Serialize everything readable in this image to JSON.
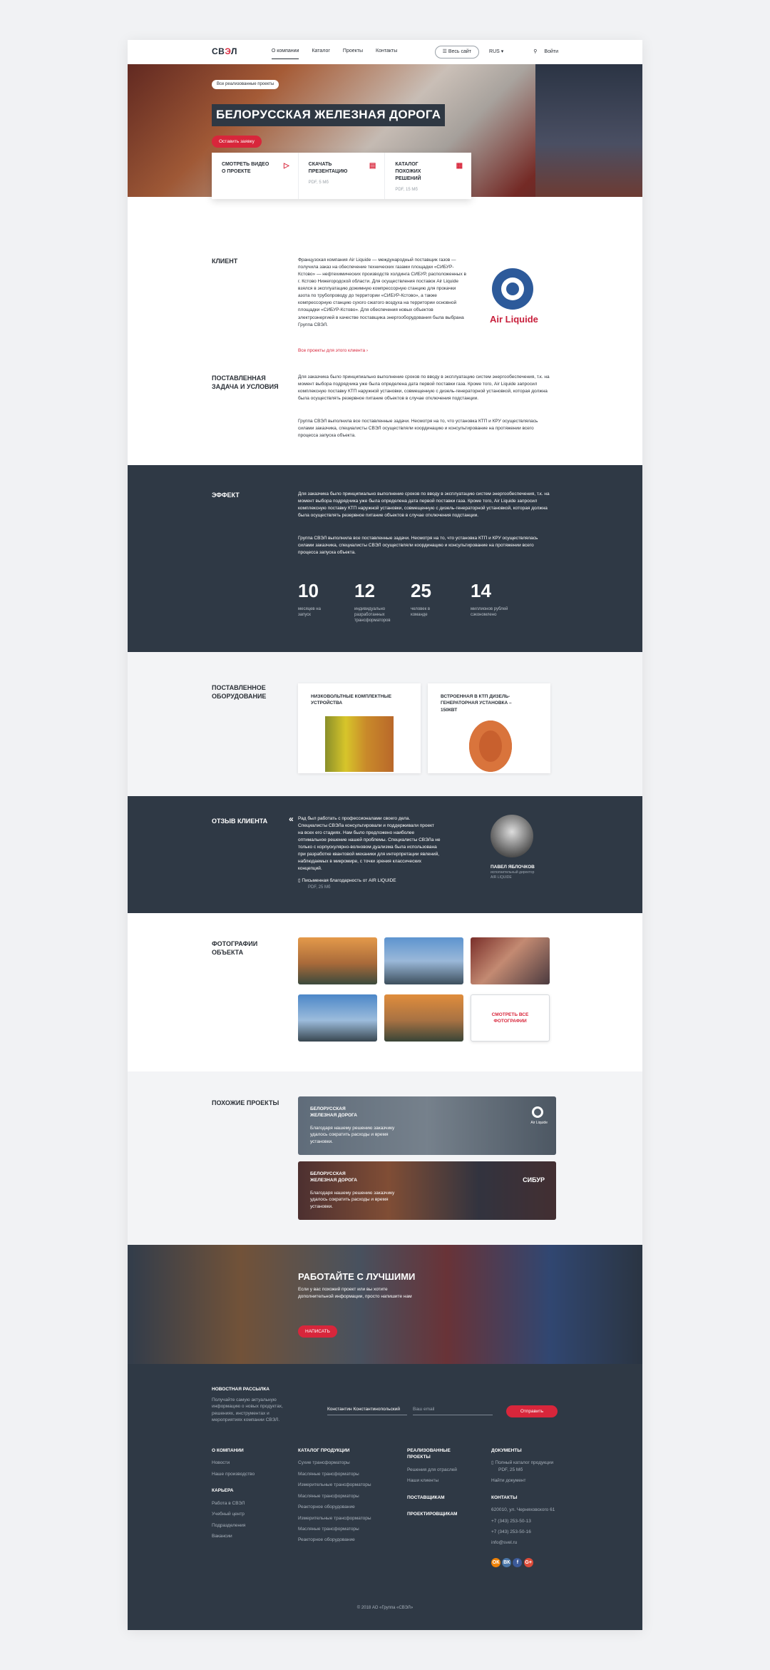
{
  "nav": {
    "logo_prefix": "СВ",
    "logo_accent": "Э",
    "logo_suffix": "Л",
    "items": [
      "О компании",
      "Каталог",
      "Проекты",
      "Контакты"
    ],
    "site_button": "Весь сайт",
    "lang": "RUS",
    "login": "Войти"
  },
  "hero": {
    "tag": "Все реализованные проекты",
    "title": "БЕЛОРУССКАЯ ЖЕЛЕЗНАЯ ДОРОГА",
    "cta": "Оставить заявку",
    "cards": [
      {
        "title": "СМОТРЕТЬ ВИДЕО О ПРОЕКТЕ",
        "sub": ""
      },
      {
        "title": "СКАЧАТЬ ПРЕЗЕНТАЦИЮ",
        "sub": "PDF, 5 Мб"
      },
      {
        "title": "КАТАЛОГ ПОХОЖИХ РЕШЕНИЙ",
        "sub": "PDF, 15 Мб"
      }
    ]
  },
  "client": {
    "heading": "КЛИЕНТ",
    "text": "Французская компания Air Liquide — международный поставщик газов — получила заказ на обеспечение технических газами площадки «СИБУР-Кстово» — нефтехимических производств холдинга СИБУР, расположенных в г. Кстово Нижегородской области. Для осуществления поставок Air Liquide взялся в эксплуатацию дожимную компрессорную станцию для прокачки азота по трубопроводу до территории «СИБУР-Кстово», а также компрессорную станцию сухого сжатого воздуха на территории основной площадки «СИБУР-Кстово». Для обеспечения новых объектов электроэнергией в качестве поставщика энергооборудования была выбрана Группа СВЭЛ.",
    "link": "Все проекты для этого клиента",
    "brand": "Air Liquide"
  },
  "task": {
    "heading": "ПОСТАВЛЕННАЯ ЗАДАЧА И УСЛОВИЯ",
    "p1": "Для заказчика было принципиально выполнение сроков по вводу в эксплуатацию систем энергообеспечения, т.к. на момент выбора подрядчика уже была определена дата первой поставки газа. Кроме того, Air Liquide запросил комплексную поставку КТП наружной установки, совмещенную с дизель-генераторной установкой, которая должна была осуществлять резервное питание объектов в случае отключения подстанции.",
    "p2": "Группа СВЭЛ выполнила все поставленные задачи. Несмотря на то, что установка КТП и КРУ осуществлялась силами заказчика, специалисты СВЭЛ осуществляли координацию и консультирование на протяжении всего процесса запуска объекта."
  },
  "effect": {
    "heading": "ЭФФЕКТ",
    "p1": "Для заказчика было принципиально выполнение сроков по вводу в эксплуатацию систем энергообеспечения, т.к. на момент выбора подрядчика уже была определена дата первой поставки газа. Кроме того, Air Liquide запросил комплексную поставку КТП наружной установки, совмещенную с дизель-генераторной установкой, которая должна была осуществлять резервное питание объектов в случае отключения подстанции.",
    "p2": "Группа СВЭЛ выполнила все поставленные задачи. Несмотря на то, что установка КТП и КРУ осуществлялась силами заказчика, специалисты СВЭЛ осуществляли координацию и консультирование на протяжении всего процесса запуска объекта.",
    "stats": [
      {
        "n": "10",
        "l": "месяцев на запуск"
      },
      {
        "n": "12",
        "l": "индивидуально разработанных трансформаторов"
      },
      {
        "n": "25",
        "l": "человек в команде"
      },
      {
        "n": "14",
        "l": "миллионов рублей сэкономлено"
      }
    ]
  },
  "equipment": {
    "heading": "ПОСТАВЛЕННОЕ ОБОРУДОВАНИЕ",
    "items": [
      "НИЗКОВОЛЬТНЫЕ КОМПЛЕКТНЫЕ УСТРОЙСТВА",
      "ВСТРОЕННАЯ В КТП ДИЗЕЛЬ-ГЕНЕРАТОРНАЯ УСТАНОВКА – 150КВТ"
    ]
  },
  "review": {
    "heading": "ОТЗЫВ КЛИЕНТА",
    "quote": "Рад был работать с профессионалами своего дела. Специалисты СВЭЛа консультировали и поддерживали проект на всех его стадиях. Нам было предложено наиболее оптимальное решение нашей проблемы. Специалисты СВЭЛа не только с корпускулярно-волновом дуализма была использована при разработке квантовой механики для интерпретации явлений, наблюдаемых в микромире, с точки зрения классических концепций.",
    "doc": "Письменная благодарность от AIR LIQUIDE",
    "doc_size": "PDF, 25 Мб",
    "person": "ПАВЕЛ ЯБЛОЧКОВ",
    "role": "исполнительный директор AIR LIQUIDE"
  },
  "photos": {
    "heading": "ФОТОГРАФИИ ОБЪЕКТА",
    "all": "СМОТРЕТЬ ВСЕ ФОТОГРАФИИ"
  },
  "similar": {
    "heading": "ПОХОЖИЕ ПРОЕКТЫ",
    "items": [
      {
        "title": "БЕЛОРУССКАЯ ЖЕЛЕЗНАЯ ДОРОГА",
        "desc": "Благодаря нашему решению заказчику удалось сократить расходы и время установки.",
        "brand": "Air Liquide"
      },
      {
        "title": "БЕЛОРУССКАЯ ЖЕЛЕЗНАЯ ДОРОГА",
        "desc": "Благодаря нашему решению заказчику удалось сократить расходы и время установки.",
        "brand": "СИБУР"
      }
    ]
  },
  "careers": {
    "title": "РАБОТАЙТЕ С ЛУЧШИМИ",
    "text": "Если у вас похожий проект или вы хотите дополнительной информации, просто напишите нам",
    "cta": "НАПИСАТЬ"
  },
  "footer": {
    "news_heading": "НОВОСТНАЯ РАССЫЛКА",
    "news_text": "Получайте самую актуальную информацию о новых продуктах, решениях, инструментах и мероприятиях компании СВЭЛ.",
    "name_value": "Константин Константинопольский",
    "email_placeholder": "Ваш email",
    "send": "Отправить",
    "col1": {
      "h1": "О КОМПАНИИ",
      "l1": [
        "Новости",
        "Наше производство"
      ],
      "h2": "КАРЬЕРА",
      "l2": [
        "Работа в СВЭЛ",
        "Учебный центр",
        "Подразделения",
        "Вакансии"
      ]
    },
    "col2": {
      "h": "КАТАЛОГ ПРОДУКЦИИ",
      "l": [
        "Сухие трансформаторы",
        "Масляные трансформаторы",
        "Измерительные трансформаторы",
        "Масляные трансформаторы",
        "Реакторное оборудование",
        "Измерительные трансформаторы",
        "Масляные трансформаторы",
        "Реакторное оборудование"
      ]
    },
    "col3": {
      "h": "РЕАЛИЗОВАННЫЕ ПРОЕКТЫ",
      "l": [
        "Решения для отраслей",
        "Наши клиенты"
      ],
      "h2": "ПОСТАВЩИКАМ",
      "h3": "ПРОЕКТИРОВЩИКАМ"
    },
    "col4": {
      "h": "ДОКУМЕНТЫ",
      "doc": "Полный каталог продукции",
      "size": "PDF, 25 Мб",
      "find": "Найти документ",
      "h2": "КОНТАКТЫ",
      "l": [
        "620010, ул. Черняховского 61",
        "+7 (343) 253-50-13",
        "+7 (343) 253-50-16",
        "info@svel.ru"
      ]
    },
    "social": [
      "ОК",
      "ВК",
      "f",
      "G+"
    ],
    "copyright": "© 2018 АО «Группа «СВЭЛ»"
  }
}
